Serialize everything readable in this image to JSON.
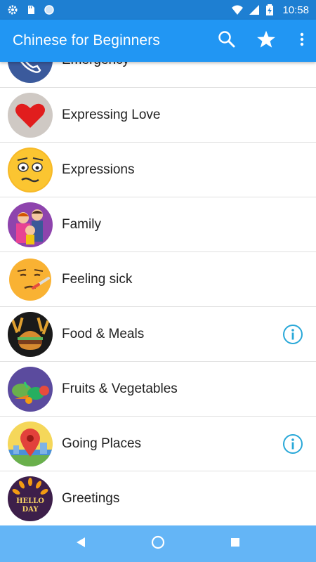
{
  "status_bar": {
    "time": "10:58",
    "left_icons": [
      "gear-icon",
      "sd-card-icon",
      "circle-icon"
    ],
    "right_icons": [
      "wifi-icon",
      "signal-icon",
      "battery-icon"
    ]
  },
  "app_bar": {
    "title": "Chinese for Beginners",
    "actions": [
      "search-icon",
      "star-icon",
      "more-vert-icon"
    ]
  },
  "categories": [
    {
      "label": "Emergency",
      "icon": "phone-plus-icon",
      "info": false
    },
    {
      "label": "Expressing Love",
      "icon": "heart-icon",
      "info": false
    },
    {
      "label": "Expressions",
      "icon": "worried-face-icon",
      "info": false
    },
    {
      "label": "Family",
      "icon": "family-icon",
      "info": false
    },
    {
      "label": "Feeling sick",
      "icon": "sick-face-icon",
      "info": false
    },
    {
      "label": "Food & Meals",
      "icon": "burger-icon",
      "info": true
    },
    {
      "label": "Fruits & Vegetables",
      "icon": "vegetables-icon",
      "info": false
    },
    {
      "label": "Going Places",
      "icon": "map-pin-icon",
      "info": true
    },
    {
      "label": "Greetings",
      "icon": "hello-day-icon",
      "info": false
    }
  ],
  "greetings_badge": {
    "line1": "HELLO",
    "line2": "DAY"
  },
  "nav_bar": {
    "buttons": [
      "back-icon",
      "home-icon",
      "recents-icon"
    ]
  },
  "colors": {
    "status_bar": "#1e7fd2",
    "app_bar": "#2196f3",
    "nav_bar": "#64b5f6",
    "info_icon": "#29a8d8"
  }
}
